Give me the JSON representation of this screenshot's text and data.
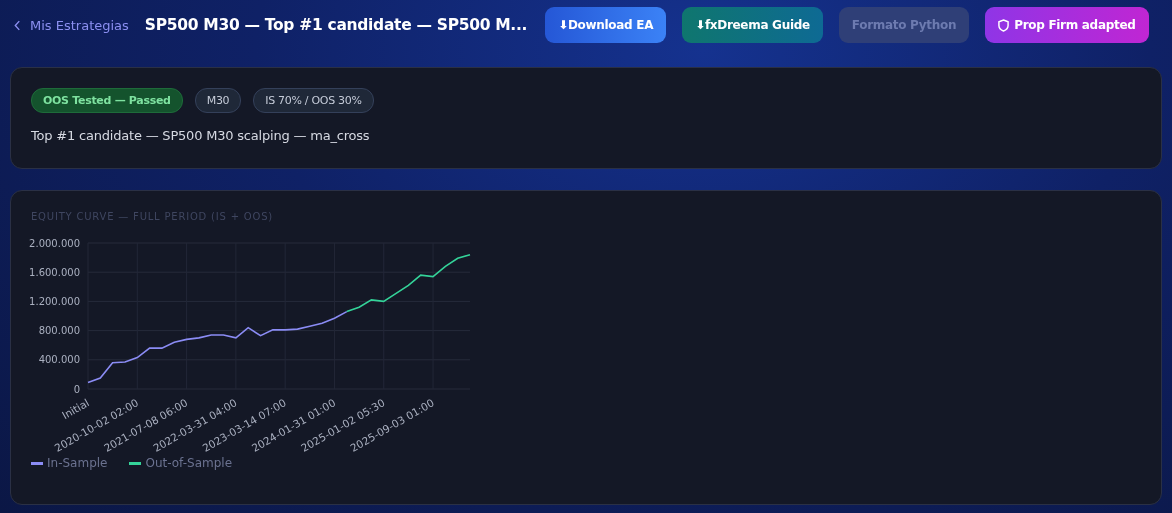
{
  "header": {
    "back_link": "Mis Estrategias",
    "title": "SP500 M30 — Top #1 candidate — SP500 M...",
    "buttons": [
      {
        "label": "⬇Download EA",
        "kind": "primary",
        "disabled": false
      },
      {
        "label": "⬇fxDreema Guide",
        "kind": "teal",
        "disabled": false
      },
      {
        "label": "Formato Python",
        "kind": "muted",
        "disabled": true
      },
      {
        "label": "Prop Firm adapted",
        "kind": "shield",
        "disabled": false
      }
    ]
  },
  "summary": {
    "badges": [
      {
        "label": "OOS Tested — Passed",
        "kind": "success"
      },
      {
        "label": "M30",
        "kind": "neutral"
      },
      {
        "label": "IS 70% / OOS 30%",
        "kind": "neutral"
      }
    ],
    "description": "Top #1 candidate — SP500 M30 scalping — ma_cross"
  },
  "equity": {
    "chart_data": {
      "type": "line",
      "title": "EQUITY CURVE — FULL PERIOD (IS + OOS)",
      "categories": [
        "Initial",
        null,
        null,
        null,
        "2020-10-02 02:00",
        null,
        null,
        null,
        "2021-07-08 06:00",
        null,
        null,
        null,
        "2022-03-31 04:00",
        null,
        null,
        null,
        "2023-03-14 07:00",
        null,
        null,
        null,
        "2024-01-31 01:00",
        null,
        null,
        null,
        "2025-01-02 05:30",
        null,
        null,
        null,
        "2025-09-03 01:00",
        null,
        null,
        null
      ],
      "series": [
        {
          "name": "In-Sample",
          "color": "#8b8cf5",
          "values": [
            90000,
            150000,
            360000,
            370000,
            430000,
            560000,
            560000,
            640000,
            680000,
            700000,
            740000,
            740000,
            700000,
            840000,
            730000,
            810000,
            810000,
            820000,
            860000,
            900000,
            970000,
            1060000,
            null,
            null,
            null,
            null,
            null,
            null,
            null,
            null,
            null,
            null
          ]
        },
        {
          "name": "Out-of-Sample",
          "color": "#34d399",
          "values": [
            null,
            null,
            null,
            null,
            null,
            null,
            null,
            null,
            null,
            null,
            null,
            null,
            null,
            null,
            null,
            null,
            null,
            null,
            null,
            null,
            null,
            1060000,
            1120000,
            1220000,
            1200000,
            1310000,
            1420000,
            1560000,
            1540000,
            1680000,
            1790000,
            1840000
          ]
        }
      ],
      "ylim": [
        0,
        2000000
      ],
      "grid": true,
      "yticks": [
        {
          "value": 0,
          "label": "0"
        },
        {
          "value": 400000,
          "label": "400.000"
        },
        {
          "value": 800000,
          "label": "800.000"
        },
        {
          "value": 1200000,
          "label": "1.200.000"
        },
        {
          "value": 1600000,
          "label": "1.600.000"
        },
        {
          "value": 2000000,
          "label": "2.000.000"
        }
      ]
    }
  }
}
